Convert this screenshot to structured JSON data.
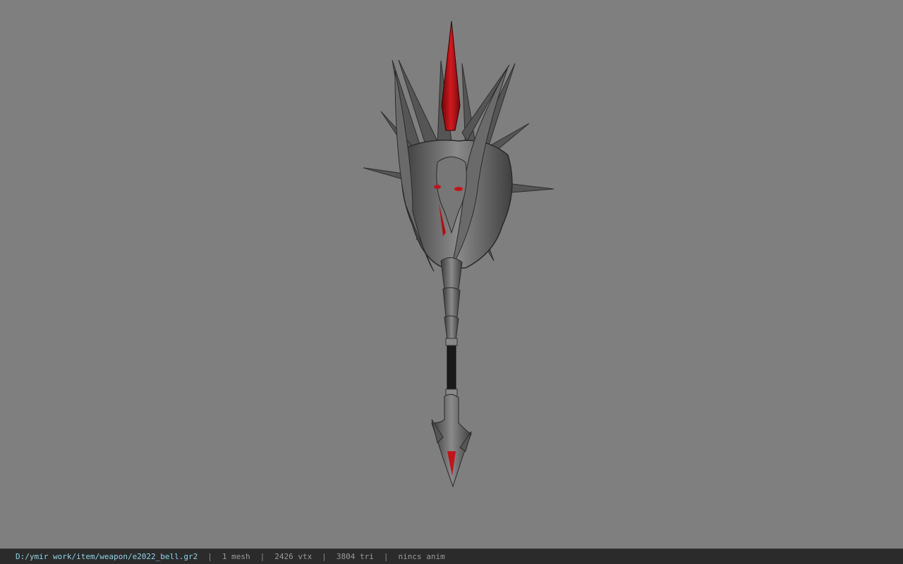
{
  "viewport": {
    "background": "#7f7f7f",
    "model_accent": "#b50f14"
  },
  "status": {
    "file_path": "D:/ymir work/item/weapon/e2022_bell.gr2",
    "separator": "|",
    "mesh_count": "1 mesh",
    "vertex_count": "2426 vtx",
    "triangle_count": "3804 tri",
    "anim": "nincs anim"
  }
}
